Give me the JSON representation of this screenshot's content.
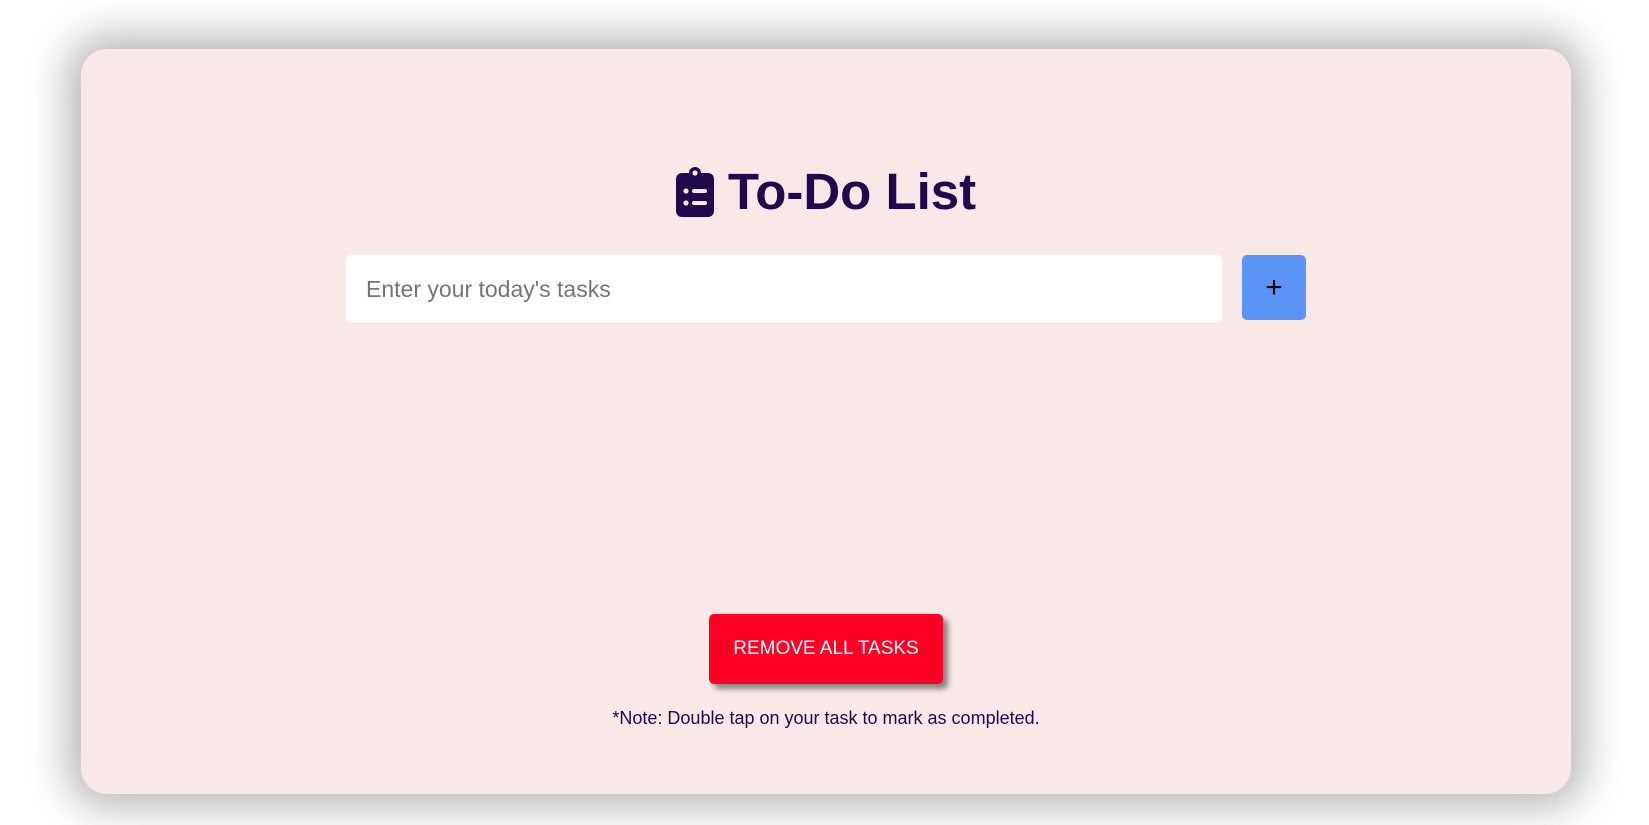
{
  "header": {
    "title": "To-Do List",
    "icon": "clipboard-list-icon"
  },
  "task_form": {
    "input_value": "",
    "input_placeholder": "Enter your today's tasks",
    "add_label": "+"
  },
  "tasks": [],
  "footer": {
    "remove_all_label": "REMOVE ALL TASKS",
    "note": "*Note: Double tap on your task to mark as completed."
  },
  "colors": {
    "card_background": "#f9e8e8",
    "text_primary": "#1e0a4c",
    "add_button": "#5b94f7",
    "remove_button": "#fe0026"
  }
}
